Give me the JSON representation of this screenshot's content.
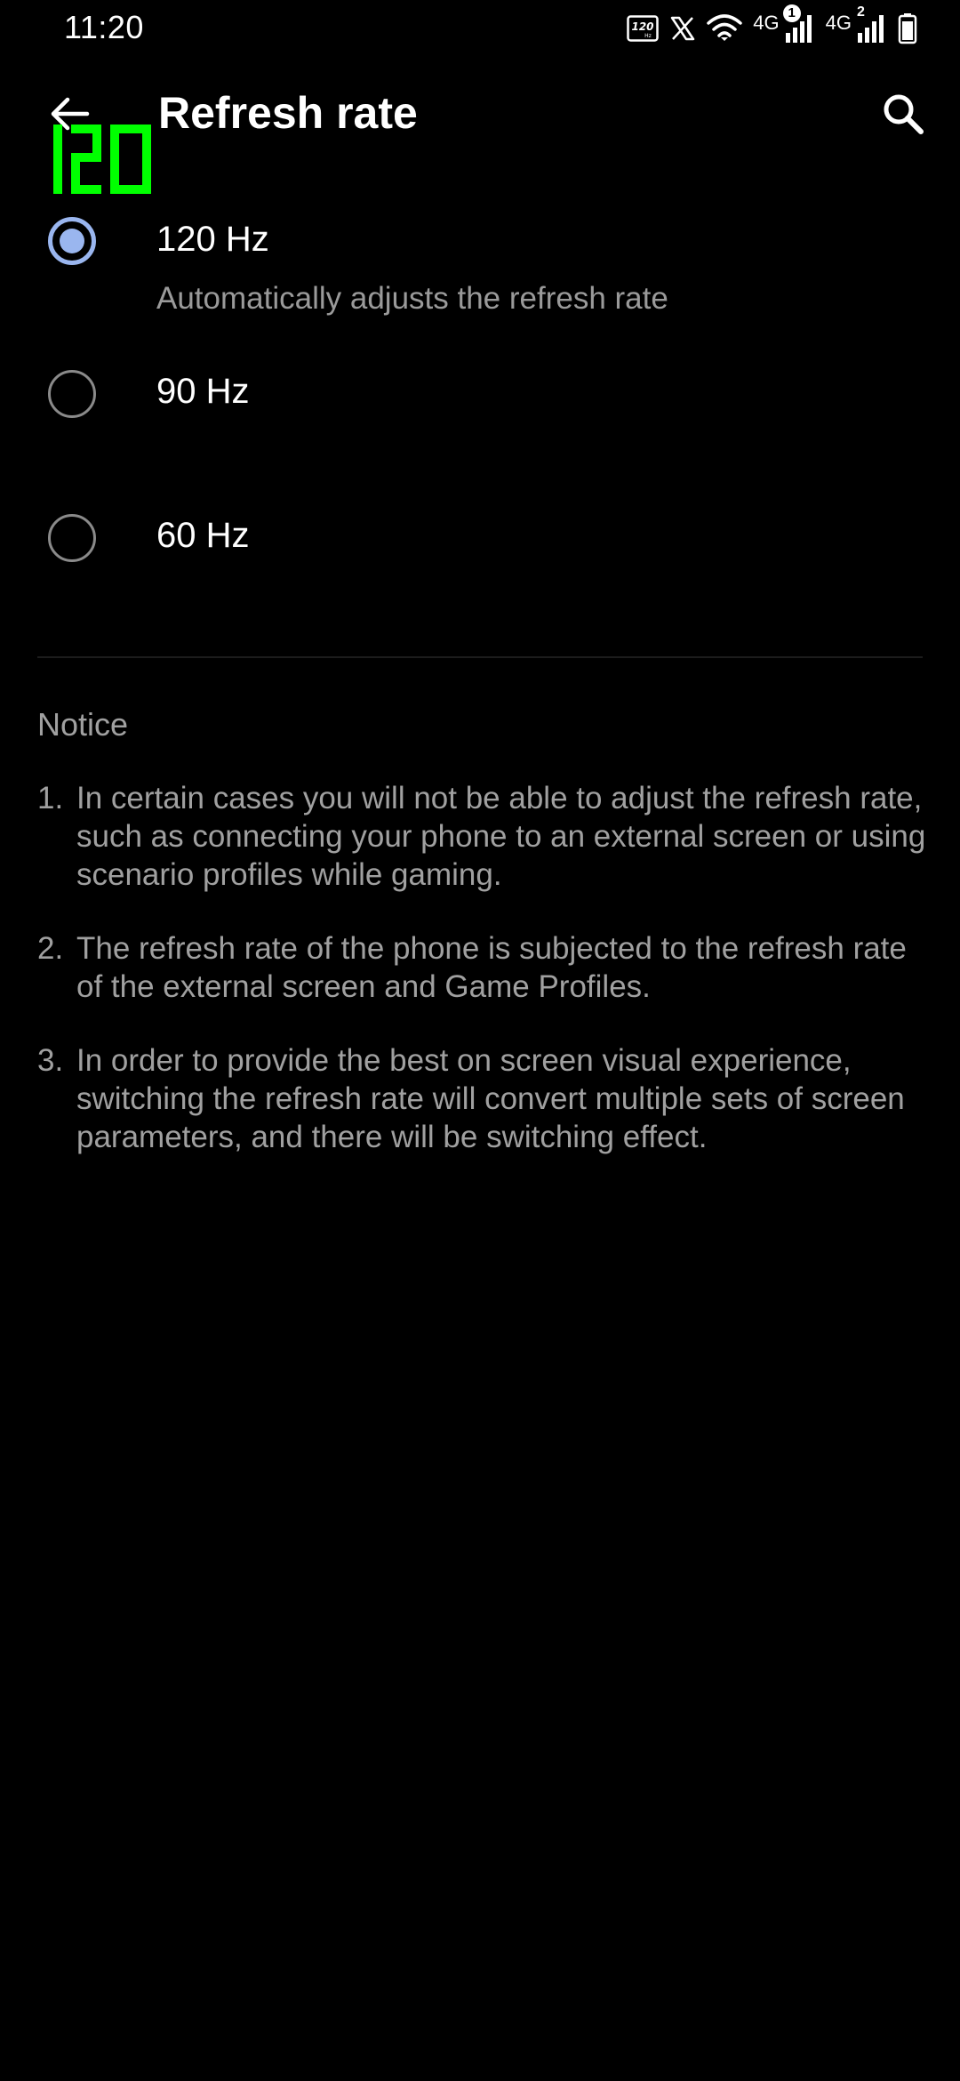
{
  "status_bar": {
    "time": "11:20",
    "icons": [
      "refresh-rate-120hz-icon",
      "x-app-icon",
      "wifi-icon",
      "signal-sim1-icon",
      "signal-sim2-icon",
      "battery-icon"
    ],
    "network_1": "4G",
    "sim_1_badge": "1",
    "network_2": "4G",
    "sim_2_badge": "2"
  },
  "app_bar": {
    "title": "Refresh rate",
    "back_icon": "arrow-back-icon",
    "search_icon": "search-icon"
  },
  "fps_overlay": {
    "value": "120",
    "color": "#00ff00"
  },
  "options": [
    {
      "label": "120 Hz",
      "summary": "Automatically adjusts the refresh rate",
      "selected": true
    },
    {
      "label": "90 Hz",
      "selected": false
    },
    {
      "label": "60 Hz",
      "selected": false
    }
  ],
  "notice": {
    "title": "Notice",
    "items": [
      {
        "num": "1.",
        "text": "In certain cases you will not be able to adjust the refresh rate, such as connecting your phone to an external screen or using scenario profiles while gaming."
      },
      {
        "num": "2.",
        "text": "The refresh rate of the phone is subjected to the refresh rate of the external screen and Game Profiles."
      },
      {
        "num": "3.",
        "text": "In order to provide the best on screen visual experience, switching the refresh rate will convert multiple sets of screen parameters, and there will be switching effect."
      }
    ]
  },
  "colors": {
    "background": "#000000",
    "accent": "#9ab6ef",
    "secondary_text": "#9a9a9a"
  }
}
